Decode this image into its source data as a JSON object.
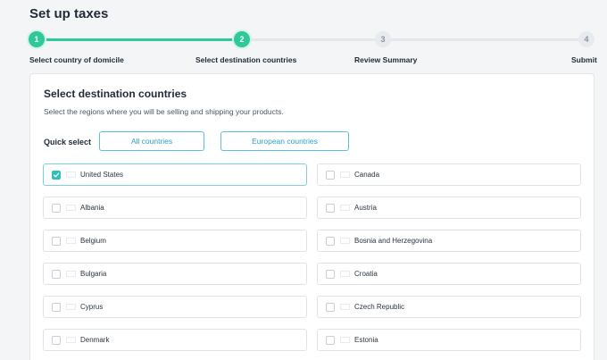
{
  "page": {
    "title": "Set up taxes"
  },
  "stepper": {
    "steps": [
      {
        "number": "1",
        "label": "Select country of domicile",
        "state": "done"
      },
      {
        "number": "2",
        "label": "Select destination countries",
        "state": "done"
      },
      {
        "number": "3",
        "label": "Review Summary",
        "state": "todo"
      },
      {
        "number": "4",
        "label": "Submit",
        "state": "todo"
      }
    ],
    "accent_color": "#2fc898"
  },
  "card": {
    "title": "Select destination countries",
    "subtitle": "Select the regions where you will be selling and shipping your products.",
    "quick_select": {
      "label": "Quick select",
      "buttons": [
        "All countries",
        "European countries"
      ]
    },
    "countries": [
      {
        "name": "United States",
        "checked": true,
        "flag": "us-flag-icon"
      },
      {
        "name": "Canada",
        "checked": false,
        "flag": "ca-flag-icon"
      },
      {
        "name": "Albania",
        "checked": false,
        "flag": "al-flag-icon"
      },
      {
        "name": "Austria",
        "checked": false,
        "flag": "at-flag-icon"
      },
      {
        "name": "Belgium",
        "checked": false,
        "flag": "be-flag-icon"
      },
      {
        "name": "Bosnia and Herzegovina",
        "checked": false,
        "flag": "ba-flag-icon"
      },
      {
        "name": "Bulgaria",
        "checked": false,
        "flag": "bg-flag-icon"
      },
      {
        "name": "Croatia",
        "checked": false,
        "flag": "hr-flag-icon"
      },
      {
        "name": "Cyprus",
        "checked": false,
        "flag": "cy-flag-icon"
      },
      {
        "name": "Czech Republic",
        "checked": false,
        "flag": "cz-flag-icon"
      },
      {
        "name": "Denmark",
        "checked": false,
        "flag": "dk-flag-icon"
      },
      {
        "name": "Estonia",
        "checked": false,
        "flag": "ee-flag-icon"
      }
    ]
  }
}
